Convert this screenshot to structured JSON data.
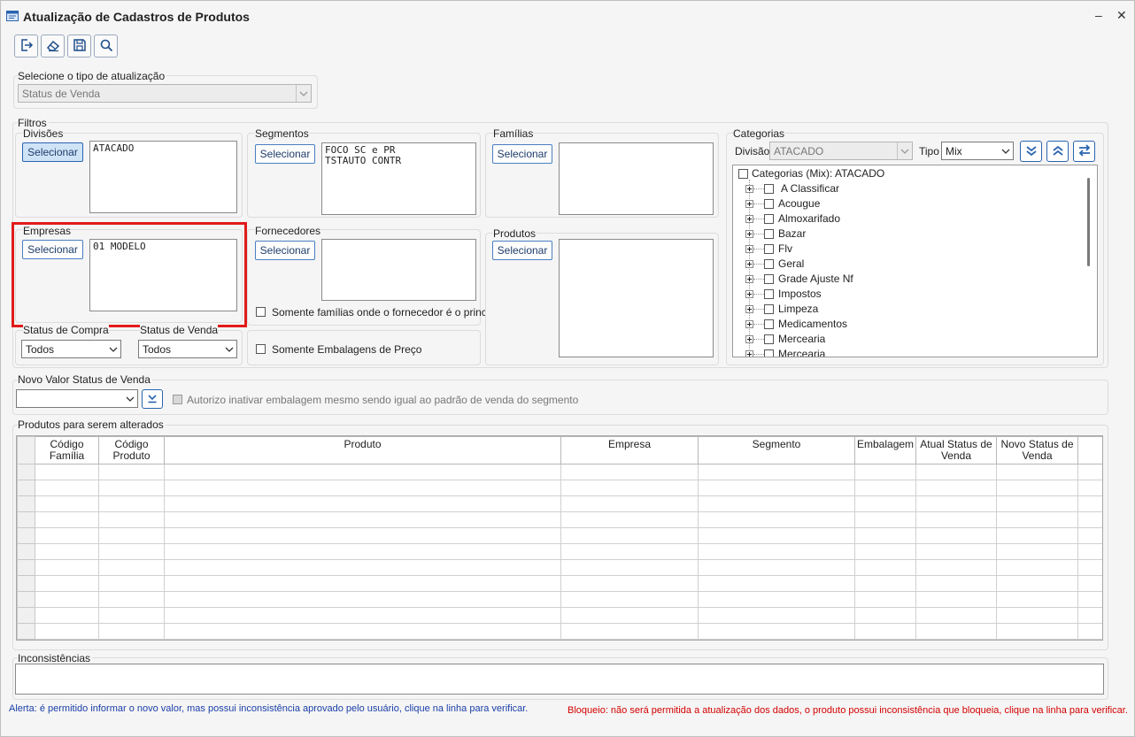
{
  "window": {
    "title": "Atualização de Cadastros de Produtos",
    "minimize": "–",
    "close": "✕"
  },
  "toolbar": {
    "icons": [
      "exit-icon",
      "eraser-icon",
      "save-icon",
      "search-icon"
    ]
  },
  "update_type": {
    "label": "Selecione o tipo de atualização",
    "value": "Status de Venda"
  },
  "filters": {
    "label": "Filtros",
    "divisoes": {
      "label": "Divisões",
      "button": "Selecionar",
      "items": [
        "ATACADO"
      ]
    },
    "segmentos": {
      "label": "Segmentos",
      "button": "Selecionar",
      "items": [
        "FOCO SC e PR",
        "TSTAUTO CONTR"
      ]
    },
    "familias": {
      "label": "Famílias",
      "button": "Selecionar",
      "items": []
    },
    "empresas": {
      "label": "Empresas",
      "button": "Selecionar",
      "items": [
        "01 MODELO"
      ]
    },
    "fornecedores": {
      "label": "Fornecedores",
      "button": "Selecionar",
      "items": [],
      "checkbox": "Somente famílias onde o fornecedor é o principal"
    },
    "produtos": {
      "label": "Produtos",
      "button": "Selecionar",
      "items": []
    },
    "status_compra": {
      "label": "Status de Compra",
      "value": "Todos"
    },
    "status_venda": {
      "label": "Status de Venda",
      "value": "Todos"
    },
    "embalagens_checkbox": "Somente Embalagens de Preço",
    "categorias": {
      "label": "Categorias",
      "divisao_label": "Divisão",
      "divisao_value": "ATACADO",
      "tipo_label": "Tipo",
      "tipo_value": "Mix",
      "root": "Categorias (Mix): ATACADO",
      "items": [
        "A Classificar",
        "Acougue",
        "Almoxarifado",
        "Bazar",
        "Flv",
        "Geral",
        "Grade Ajuste Nf",
        "Impostos",
        "Limpeza",
        "Medicamentos",
        "Mercearia",
        "Mercearia"
      ]
    }
  },
  "novo_valor": {
    "label": "Novo Valor Status de Venda",
    "value": "",
    "checkbox": "Autorizo inativar embalagem mesmo sendo igual ao padrão de venda do segmento"
  },
  "grid": {
    "label": "Produtos para serem alterados",
    "columns": [
      "Código Família",
      "Código Produto",
      "Produto",
      "Empresa",
      "Segmento",
      "Embalagem",
      "Atual Status de Venda",
      "Novo Status de Venda"
    ]
  },
  "inconsistencias": {
    "label": "Inconsistências"
  },
  "alerts": {
    "alerta": "Alerta: é permitido informar o novo valor, mas possui inconsistência aprovado pelo usuário, clique na linha para verificar.",
    "bloqueio": "Bloqueio: não será permitida a atualização dos dados, o produto possui inconsistência que bloqueia, clique na linha para verificar."
  },
  "colors": {
    "accent": "#2a64b0",
    "highlight": "#e11b1b",
    "alert_blue": "#1a3fa8",
    "alert_red": "#d40000"
  }
}
